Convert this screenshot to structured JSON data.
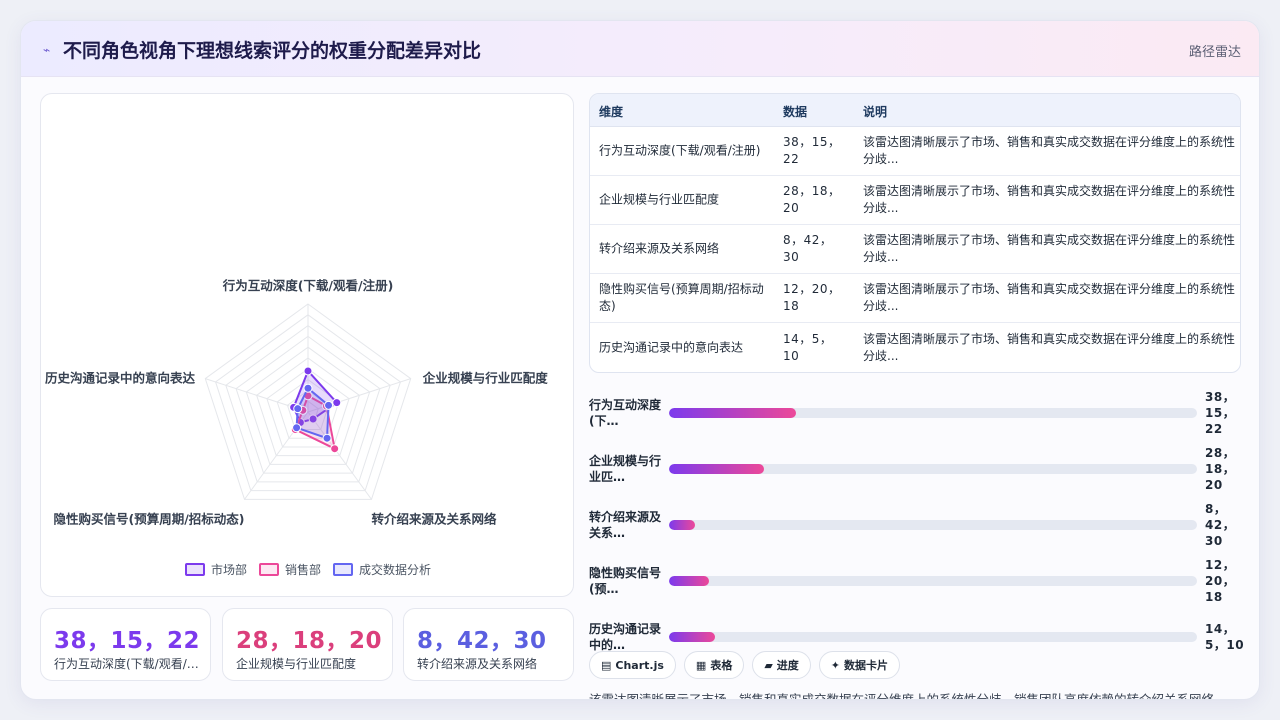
{
  "header": {
    "icon": "pulse-icon",
    "title": "不同角色视角下理想线索评分的权重分配差异对比",
    "tag": "路径雷达"
  },
  "colors": {
    "market": "#7c3aed",
    "sales": "#ec4899",
    "deal": "#6366f1",
    "grid": "#e5e7eb"
  },
  "chart_data": {
    "type": "radar",
    "categories": [
      "行为互动深度(下载/观看/注册)",
      "企业规模与行业匹配度",
      "转介绍来源及关系网络",
      "隐性购买信号(预算周期/招标动态)",
      "历史沟通记录中的意向表达"
    ],
    "series": [
      {
        "name": "市场部",
        "values": [
          38,
          28,
          8,
          12,
          14
        ]
      },
      {
        "name": "销售部",
        "values": [
          15,
          18,
          42,
          20,
          5
        ]
      },
      {
        "name": "成交数据分析",
        "values": [
          22,
          20,
          30,
          18,
          10
        ]
      }
    ],
    "rmax": 100,
    "grid_levels": 10,
    "legend": "bottom"
  },
  "stats": [
    {
      "value": "38，15，22",
      "label": "行为互动深度(下载/观看/注册)"
    },
    {
      "value": "28，18，20",
      "label": "企业规模与行业匹配度"
    },
    {
      "value": "8，42，30",
      "label": "转介绍来源及关系网络"
    }
  ],
  "table": {
    "headers": {
      "dim": "维度",
      "data": "数据",
      "desc": "说明"
    },
    "rows": [
      {
        "dim": "行为互动深度(下载/观看/注册)",
        "data": "38，15，22",
        "desc": "该雷达图清晰展示了市场、销售和真实成交数据在评分维度上的系统性分歧..."
      },
      {
        "dim": "企业规模与行业匹配度",
        "data": "28，18，20",
        "desc": "该雷达图清晰展示了市场、销售和真实成交数据在评分维度上的系统性分歧..."
      },
      {
        "dim": "转介绍来源及关系网络",
        "data": "8，42，30",
        "desc": "该雷达图清晰展示了市场、销售和真实成交数据在评分维度上的系统性分歧..."
      },
      {
        "dim": "隐性购买信号(预算周期/招标动态)",
        "data": "12，20，18",
        "desc": "该雷达图清晰展示了市场、销售和真实成交数据在评分维度上的系统性分歧..."
      },
      {
        "dim": "历史沟通记录中的意向表达",
        "data": "14，5，10",
        "desc": "该雷达图清晰展示了市场、销售和真实成交数据在评分维度上的系统性分歧..."
      }
    ]
  },
  "bars": [
    {
      "label": "行为互动深度(下…",
      "value": "38，15，22",
      "fraction": 0.24
    },
    {
      "label": "企业规模与行业匹…",
      "value": "28，18，20",
      "fraction": 0.18
    },
    {
      "label": "转介绍来源及关系…",
      "value": "8，42，30",
      "fraction": 0.05
    },
    {
      "label": "隐性购买信号(预…",
      "value": "12，20，18",
      "fraction": 0.075
    },
    {
      "label": "历史沟通记录中的…",
      "value": "14，5，10",
      "fraction": 0.088
    }
  ],
  "chips": [
    {
      "icon": "chart-icon",
      "label": "Chart.js"
    },
    {
      "icon": "table-icon",
      "label": "表格"
    },
    {
      "icon": "progress-icon",
      "label": "进度"
    },
    {
      "icon": "sparkle-icon",
      "label": "数据卡片"
    }
  ],
  "footer": "该雷达图清晰展示了市场、销售和真实成交数据在评分维度上的系统性分歧，销售团队高度依赖的转介绍关系网络"
}
